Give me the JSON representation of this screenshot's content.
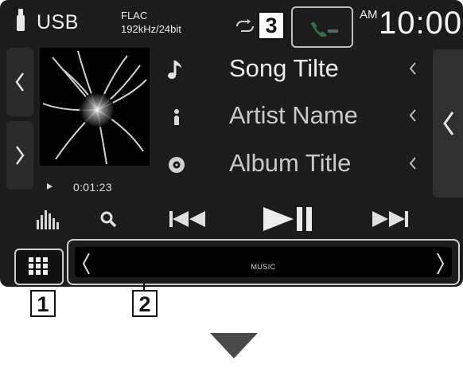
{
  "status_bar": {
    "source": "USB",
    "format_line1": "FLAC",
    "format_line2": "192kHz/24bit",
    "ampm": "AM",
    "clock": "10:00",
    "icons": [
      "usb-icon",
      "repeat-icon",
      "phone-status-icon"
    ]
  },
  "track": {
    "song_title": "Song Tilte",
    "artist_name": "Artist Name",
    "album_title": "Album Title",
    "elapsed": "0:01:23",
    "icons": [
      "music-note-icon",
      "artist-icon",
      "album-disc-icon"
    ]
  },
  "controls": {
    "icons": [
      "equalizer-icon",
      "search-icon",
      "previous-track-icon",
      "play-pause-icon",
      "next-track-icon"
    ]
  },
  "bottom": {
    "menu_icon": "grid-menu-icon",
    "content_label": "MUSIC"
  },
  "callouts": {
    "one": "1",
    "two": "2",
    "three": "3"
  },
  "colors": {
    "screen_bg": "#1c1c1c",
    "text": "#ececec",
    "callout_border": "#111111",
    "arrow": "#4a4a4a"
  }
}
